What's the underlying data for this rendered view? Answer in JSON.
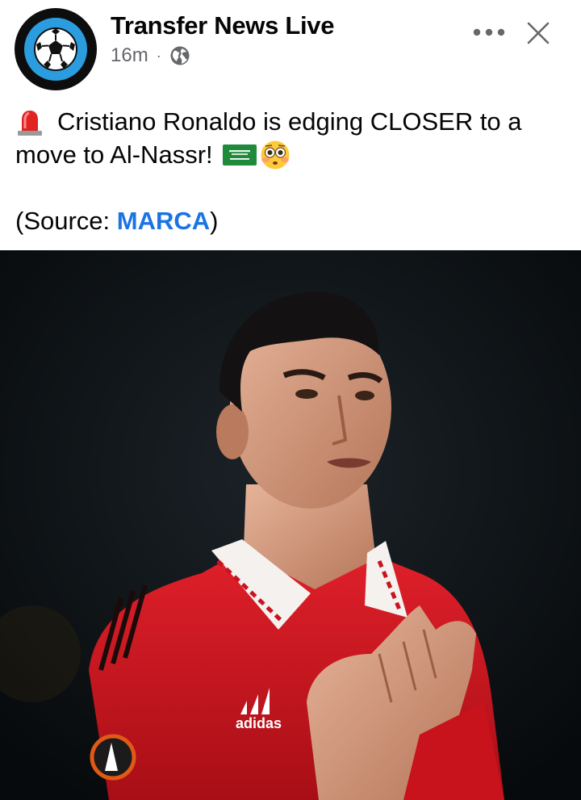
{
  "post": {
    "page_name": "Transfer News Live",
    "timestamp": "16m",
    "separator": "·",
    "audience_icon": "globe-icon",
    "more_icon": "more-horizontal-icon",
    "close_icon": "close-icon",
    "text_line1": "Cristiano Ronaldo is edging CLOSER to a",
    "text_line2": "move to Al-Nassr!",
    "source_prefix": "(Source: ",
    "source_link": "MARCA",
    "source_suffix": ")",
    "leading_emoji": "siren-emoji",
    "trailing_emojis": [
      "saudi-flag-emoji",
      "flushed-face-emoji"
    ],
    "photo_brand": "adidas"
  },
  "colors": {
    "link": "#1b74e4",
    "meta": "#65676b",
    "avatar_ring": "#2b9ddf",
    "jersey_red": "#d0141e"
  }
}
